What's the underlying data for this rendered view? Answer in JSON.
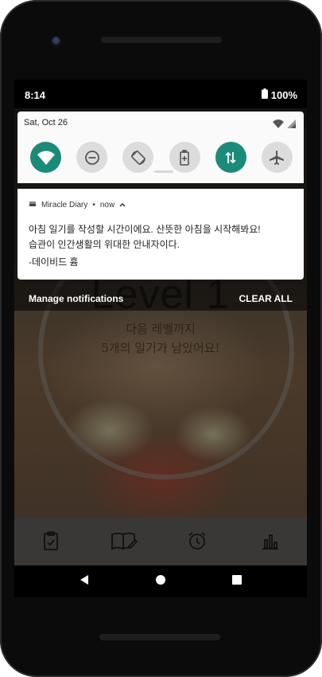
{
  "status": {
    "time": "8:14",
    "battery_percent": "100%"
  },
  "quick_settings": {
    "date": "Sat, Oct 26",
    "tiles": [
      {
        "icon": "wifi-icon",
        "state": "on"
      },
      {
        "icon": "dnd-icon",
        "state": "off"
      },
      {
        "icon": "auto-rotate-icon",
        "state": "off"
      },
      {
        "icon": "battery-saver-icon",
        "state": "off"
      },
      {
        "icon": "mobile-data-icon",
        "state": "on"
      },
      {
        "icon": "airplane-icon",
        "state": "off"
      }
    ]
  },
  "notification": {
    "app_name": "Miracle Diary",
    "time": "now",
    "line1": "아침 일기를 작성할 시간이에요. 산뜻한 아침을 시작해봐요!",
    "line2": "습관이 인간생활의 위대한 안내자이다.",
    "line3": "-데이비드 흄"
  },
  "shade_actions": {
    "manage": "Manage notifications",
    "clear": "CLEAR ALL"
  },
  "app": {
    "level_title": "Level 1",
    "sub1": "다음 레벨까지",
    "sub2": "5개의 일기가 남았어요!"
  },
  "colors": {
    "accent_teal": "#1b8b79"
  }
}
